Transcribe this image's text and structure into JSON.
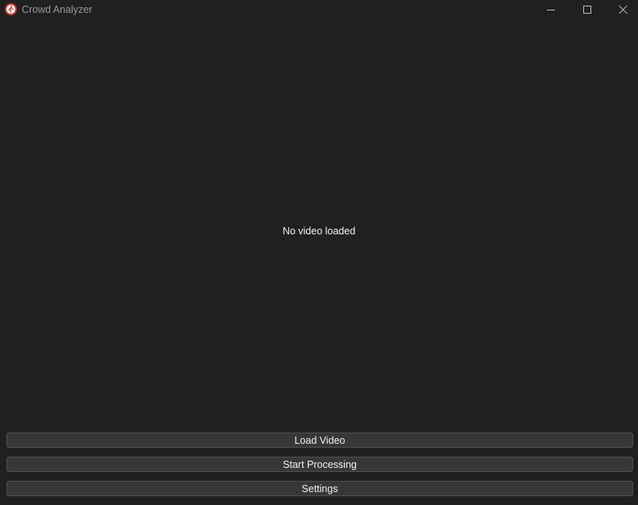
{
  "window": {
    "title": "Crowd Analyzer",
    "app_icon": "running-person-icon"
  },
  "titlebar_controls": {
    "minimize": "minimize-icon",
    "maximize": "maximize-icon",
    "close": "close-icon"
  },
  "video": {
    "placeholder_text": "No video loaded"
  },
  "actions": {
    "load_video_label": "Load Video",
    "start_processing_label": "Start Processing",
    "settings_label": "Settings"
  },
  "colors": {
    "background": "#202020",
    "button_bg": "#373737",
    "button_border": "#4f4f4f",
    "text": "#f0f0f0",
    "title_text": "#9a9a9a",
    "icon_ring": "#c0392b"
  }
}
